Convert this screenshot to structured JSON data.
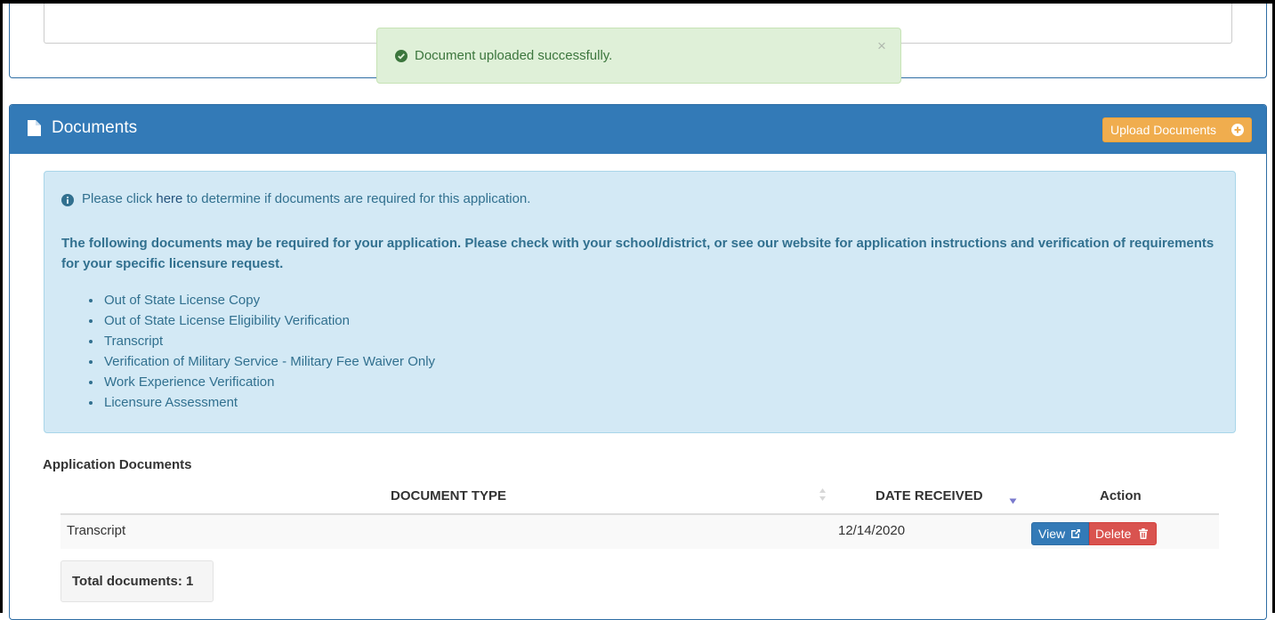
{
  "alert": {
    "message": "Document uploaded successfully.",
    "close_symbol": "×",
    "icon": "check-circle-icon"
  },
  "panel": {
    "title": "Documents",
    "upload_label": "Upload Documents",
    "heading_color": "#337ab7",
    "upload_color": "#f0ad4e"
  },
  "info": {
    "prefix": "Please click ",
    "link_text": "here",
    "suffix": " to determine if documents are required for this application.",
    "lead": "The following documents may be required for your application. Please check with your school/district, or see our website for application instructions and verification of requirements for your specific licensure request.",
    "items": [
      "Out of State License Copy",
      "Out of State License Eligibility Verification",
      "Transcript",
      "Verification of Military Service - Military Fee Waiver Only",
      "Work Experience Verification",
      "Licensure Assessment"
    ]
  },
  "documents": {
    "section_title": "Application Documents",
    "columns": [
      "DOCUMENT TYPE",
      "DATE RECEIVED",
      "Action"
    ],
    "rows": [
      {
        "type": "Transcript",
        "date": "12/14/2020"
      }
    ],
    "view_label": "View",
    "delete_label": "Delete",
    "total_label": "Total documents: 1"
  }
}
